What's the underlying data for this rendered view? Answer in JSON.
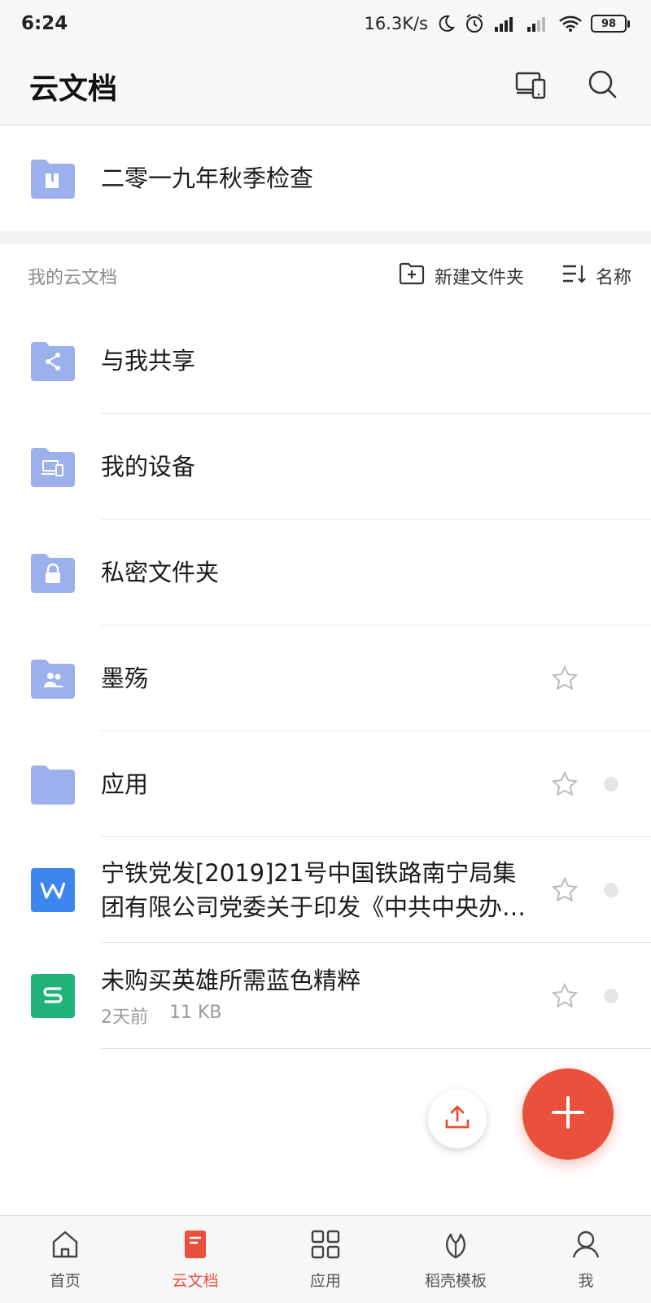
{
  "status_bar": {
    "time": "6:24",
    "net_speed": "16.3K/s",
    "battery": "98",
    "icons": [
      "moon-icon",
      "alarm-icon",
      "signal-icon",
      "signal-icon",
      "wifi-icon",
      "battery-icon"
    ]
  },
  "header": {
    "title": "云文档",
    "actions": [
      "devices-icon",
      "search-icon"
    ]
  },
  "pinned": {
    "title": "二零一九年秋季检查",
    "icon": "shared-folder-icon"
  },
  "section": {
    "label": "我的云文档",
    "new_folder": "新建文件夹",
    "sort_label": "名称"
  },
  "rows": [
    {
      "title": "与我共享",
      "icon": "share-folder-icon"
    },
    {
      "title": "我的设备",
      "icon": "device-folder-icon"
    },
    {
      "title": "私密文件夹",
      "icon": "lock-folder-icon"
    },
    {
      "title": "墨殇",
      "icon": "group-folder-icon",
      "star": true
    },
    {
      "title": "应用",
      "icon": "folder-icon",
      "star": true,
      "dot": true
    },
    {
      "title": "宁铁党发[2019]21号中国铁路南宁局集团有限公司党委关于印发《中共中央办公厅...",
      "icon": "wps-writer-icon",
      "star": true,
      "dot": true
    },
    {
      "title": "未购买英雄所需蓝色精粹",
      "icon": "wps-sheet-icon",
      "star": true,
      "dot": true,
      "meta_time": "2天前",
      "meta_size": "11 KB"
    }
  ],
  "bottom_nav": [
    {
      "label": "首页",
      "icon": "home-icon"
    },
    {
      "label": "云文档",
      "icon": "cloud-doc-icon",
      "active": true
    },
    {
      "label": "应用",
      "icon": "apps-grid-icon"
    },
    {
      "label": "稻壳模板",
      "icon": "leaf-icon"
    },
    {
      "label": "我",
      "icon": "user-icon"
    }
  ],
  "colors": {
    "accent": "#e9513c",
    "folder": "#9bb0ec",
    "wps_writer": "#3e86ed",
    "wps_sheet": "#21b27a"
  }
}
